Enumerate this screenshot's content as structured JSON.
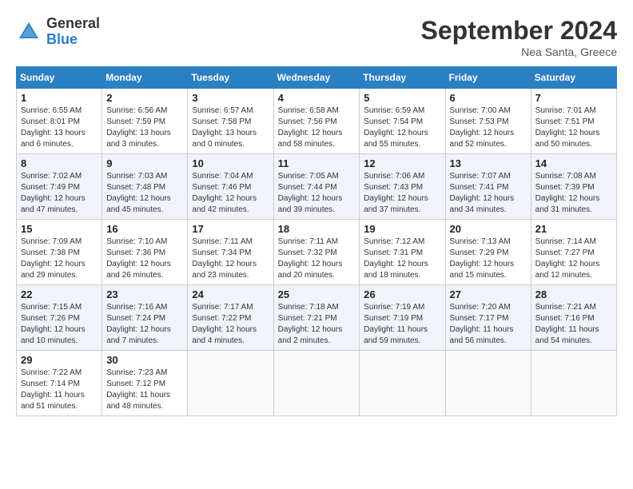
{
  "header": {
    "logo_general": "General",
    "logo_blue": "Blue",
    "month_title": "September 2024",
    "location": "Nea Santa, Greece"
  },
  "weekdays": [
    "Sunday",
    "Monday",
    "Tuesday",
    "Wednesday",
    "Thursday",
    "Friday",
    "Saturday"
  ],
  "weeks": [
    [
      {
        "day": "1",
        "info": "Sunrise: 6:55 AM\nSunset: 8:01 PM\nDaylight: 13 hours\nand 6 minutes."
      },
      {
        "day": "2",
        "info": "Sunrise: 6:56 AM\nSunset: 7:59 PM\nDaylight: 13 hours\nand 3 minutes."
      },
      {
        "day": "3",
        "info": "Sunrise: 6:57 AM\nSunset: 7:58 PM\nDaylight: 13 hours\nand 0 minutes."
      },
      {
        "day": "4",
        "info": "Sunrise: 6:58 AM\nSunset: 7:56 PM\nDaylight: 12 hours\nand 58 minutes."
      },
      {
        "day": "5",
        "info": "Sunrise: 6:59 AM\nSunset: 7:54 PM\nDaylight: 12 hours\nand 55 minutes."
      },
      {
        "day": "6",
        "info": "Sunrise: 7:00 AM\nSunset: 7:53 PM\nDaylight: 12 hours\nand 52 minutes."
      },
      {
        "day": "7",
        "info": "Sunrise: 7:01 AM\nSunset: 7:51 PM\nDaylight: 12 hours\nand 50 minutes."
      }
    ],
    [
      {
        "day": "8",
        "info": "Sunrise: 7:02 AM\nSunset: 7:49 PM\nDaylight: 12 hours\nand 47 minutes."
      },
      {
        "day": "9",
        "info": "Sunrise: 7:03 AM\nSunset: 7:48 PM\nDaylight: 12 hours\nand 45 minutes."
      },
      {
        "day": "10",
        "info": "Sunrise: 7:04 AM\nSunset: 7:46 PM\nDaylight: 12 hours\nand 42 minutes."
      },
      {
        "day": "11",
        "info": "Sunrise: 7:05 AM\nSunset: 7:44 PM\nDaylight: 12 hours\nand 39 minutes."
      },
      {
        "day": "12",
        "info": "Sunrise: 7:06 AM\nSunset: 7:43 PM\nDaylight: 12 hours\nand 37 minutes."
      },
      {
        "day": "13",
        "info": "Sunrise: 7:07 AM\nSunset: 7:41 PM\nDaylight: 12 hours\nand 34 minutes."
      },
      {
        "day": "14",
        "info": "Sunrise: 7:08 AM\nSunset: 7:39 PM\nDaylight: 12 hours\nand 31 minutes."
      }
    ],
    [
      {
        "day": "15",
        "info": "Sunrise: 7:09 AM\nSunset: 7:38 PM\nDaylight: 12 hours\nand 29 minutes."
      },
      {
        "day": "16",
        "info": "Sunrise: 7:10 AM\nSunset: 7:36 PM\nDaylight: 12 hours\nand 26 minutes."
      },
      {
        "day": "17",
        "info": "Sunrise: 7:11 AM\nSunset: 7:34 PM\nDaylight: 12 hours\nand 23 minutes."
      },
      {
        "day": "18",
        "info": "Sunrise: 7:11 AM\nSunset: 7:32 PM\nDaylight: 12 hours\nand 20 minutes."
      },
      {
        "day": "19",
        "info": "Sunrise: 7:12 AM\nSunset: 7:31 PM\nDaylight: 12 hours\nand 18 minutes."
      },
      {
        "day": "20",
        "info": "Sunrise: 7:13 AM\nSunset: 7:29 PM\nDaylight: 12 hours\nand 15 minutes."
      },
      {
        "day": "21",
        "info": "Sunrise: 7:14 AM\nSunset: 7:27 PM\nDaylight: 12 hours\nand 12 minutes."
      }
    ],
    [
      {
        "day": "22",
        "info": "Sunrise: 7:15 AM\nSunset: 7:26 PM\nDaylight: 12 hours\nand 10 minutes."
      },
      {
        "day": "23",
        "info": "Sunrise: 7:16 AM\nSunset: 7:24 PM\nDaylight: 12 hours\nand 7 minutes."
      },
      {
        "day": "24",
        "info": "Sunrise: 7:17 AM\nSunset: 7:22 PM\nDaylight: 12 hours\nand 4 minutes."
      },
      {
        "day": "25",
        "info": "Sunrise: 7:18 AM\nSunset: 7:21 PM\nDaylight: 12 hours\nand 2 minutes."
      },
      {
        "day": "26",
        "info": "Sunrise: 7:19 AM\nSunset: 7:19 PM\nDaylight: 11 hours\nand 59 minutes."
      },
      {
        "day": "27",
        "info": "Sunrise: 7:20 AM\nSunset: 7:17 PM\nDaylight: 11 hours\nand 56 minutes."
      },
      {
        "day": "28",
        "info": "Sunrise: 7:21 AM\nSunset: 7:16 PM\nDaylight: 11 hours\nand 54 minutes."
      }
    ],
    [
      {
        "day": "29",
        "info": "Sunrise: 7:22 AM\nSunset: 7:14 PM\nDaylight: 11 hours\nand 51 minutes."
      },
      {
        "day": "30",
        "info": "Sunrise: 7:23 AM\nSunset: 7:12 PM\nDaylight: 11 hours\nand 48 minutes."
      },
      null,
      null,
      null,
      null,
      null
    ]
  ]
}
